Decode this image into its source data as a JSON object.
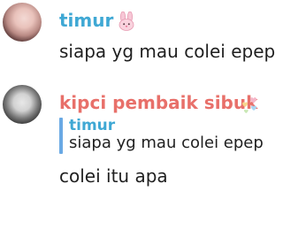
{
  "colors": {
    "user1": "#3fa8d4",
    "user2": "#e8706a",
    "reply_name": "#3fa8d4"
  },
  "messages": [
    {
      "username": "timur",
      "badge_icon": "bunny-icon",
      "text": "siapa yg mau colei epep"
    },
    {
      "username": "kipci pembaik sibuk",
      "badge_icon": "hearts-icon",
      "reply": {
        "username": "timur",
        "text": "siapa yg mau colei epep"
      },
      "text": "colei itu apa"
    }
  ]
}
